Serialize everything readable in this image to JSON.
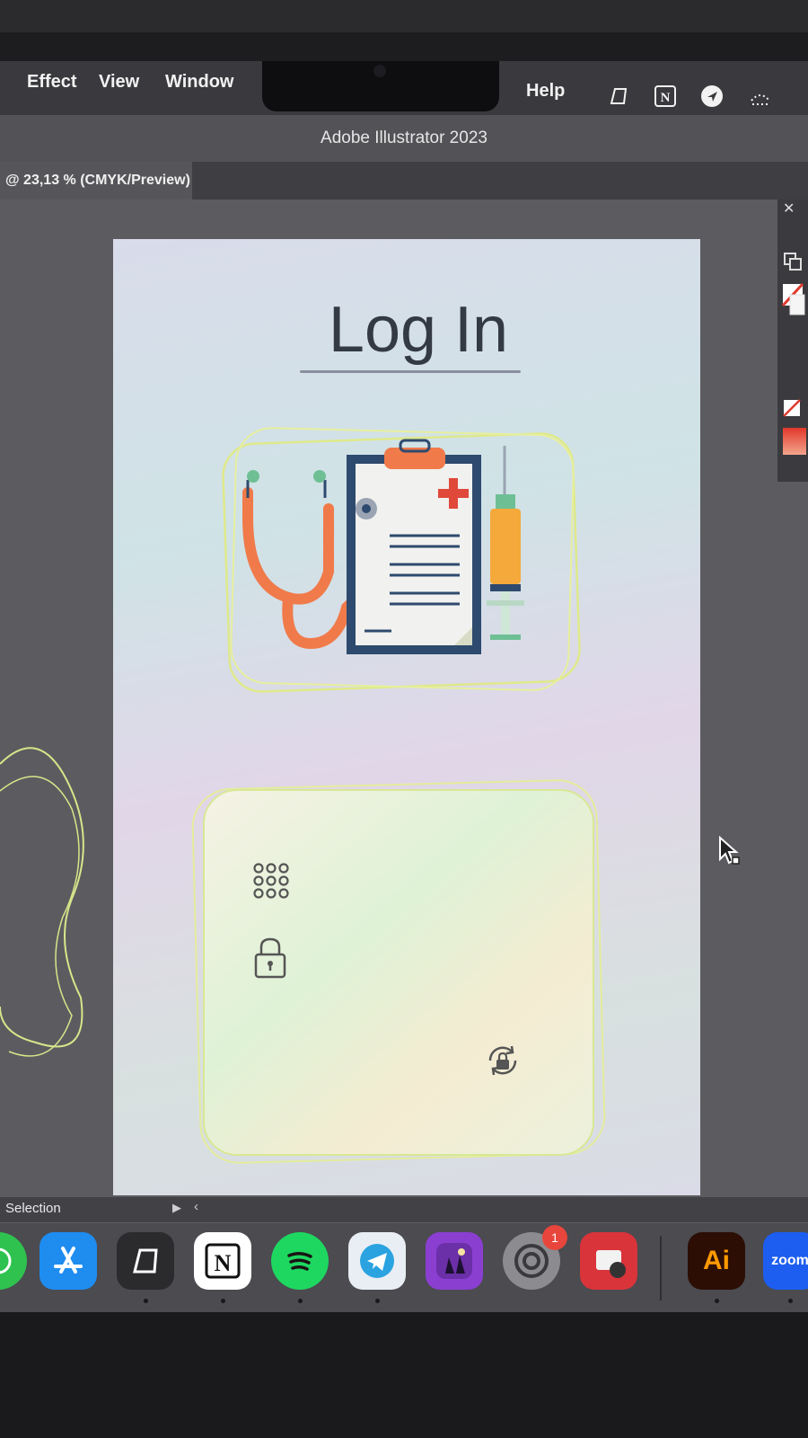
{
  "menubar": {
    "items": [
      "Effect",
      "View",
      "Window"
    ],
    "help": "Help"
  },
  "window": {
    "title": "Adobe Illustrator 2023",
    "tab_label": "@ 23,13 % (CMYK/Preview)"
  },
  "artboard": {
    "heading": "Log In"
  },
  "statusbar": {
    "tool": "Selection"
  },
  "dock": {
    "apps": [
      "whatsapp",
      "app-store",
      "craft",
      "notion",
      "spotify",
      "telegram",
      "game",
      "system-settings",
      "photo-booth",
      "illustrator",
      "zoom"
    ],
    "settings_badge": "1",
    "illustrator_label": "Ai",
    "zoom_label": "zoom"
  },
  "colors": {
    "menubar": "#3a3a3e",
    "titlebar": "#535357",
    "artboard_text": "#333a44",
    "accent_orange": "#f07a4a",
    "clipboard_blue": "#2e4a6e"
  }
}
